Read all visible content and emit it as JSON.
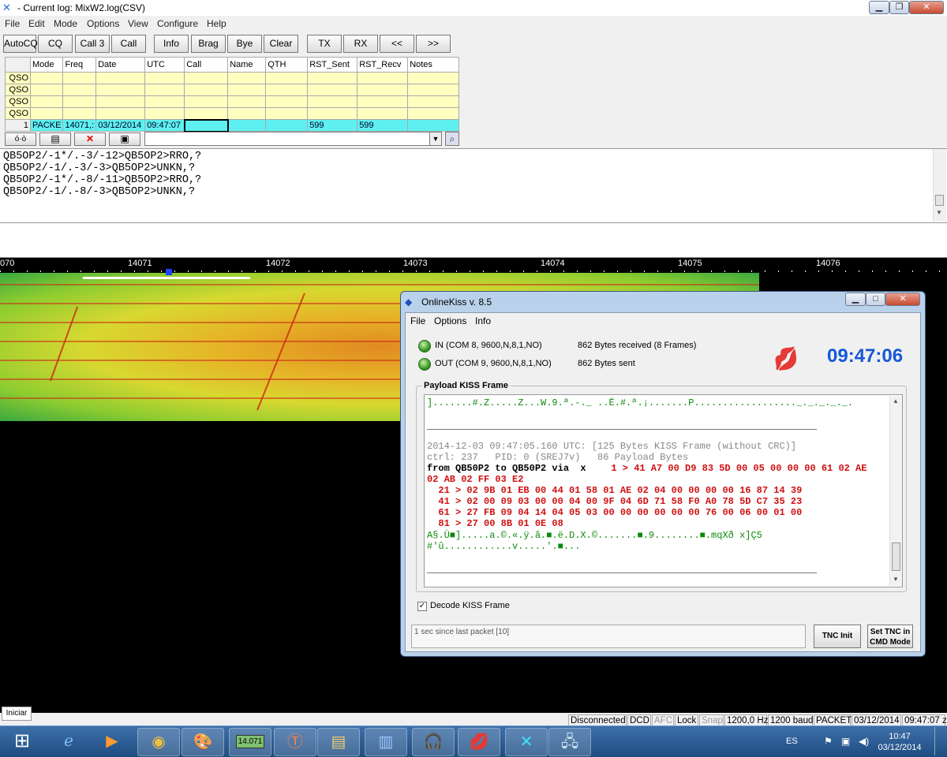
{
  "window": {
    "title": "- Current log: MixW2.log(CSV)",
    "min": "▁",
    "max": "❐",
    "close": "✕"
  },
  "menu": [
    "File",
    "Edit",
    "Mode",
    "Options",
    "View",
    "Configure",
    "Help"
  ],
  "toolbar": [
    "AutoCQ",
    "CQ",
    "Call 3",
    "Call",
    "Info",
    "Brag",
    "Bye",
    "Clear",
    "TX",
    "RX",
    "<<",
    ">>"
  ],
  "log": {
    "headers": [
      "",
      "Mode",
      "Freq",
      "Date",
      "UTC",
      "Call",
      "Name",
      "QTH",
      "RST_Sent",
      "RST_Recv",
      "Notes"
    ],
    "rows": [
      [
        "QSO",
        "",
        "",
        "",
        "",
        "",
        "",
        "",
        "",
        "",
        ""
      ],
      [
        "QSO",
        "",
        "",
        "",
        "",
        "",
        "",
        "",
        "",
        "",
        ""
      ],
      [
        "QSO",
        "",
        "",
        "",
        "",
        "",
        "",
        "",
        "",
        "",
        ""
      ],
      [
        "QSO",
        "",
        "",
        "",
        "",
        "",
        "",
        "",
        "",
        "",
        ""
      ],
      [
        "1",
        "PACKE",
        "14071,:",
        "03/12/2014",
        "09:47:07",
        "",
        "",
        "",
        "599",
        "599",
        ""
      ]
    ]
  },
  "rx_lines": [
    "QB5OP2/-1*/.-3/-12>QB5OP2>RRO,?",
    "QB5OP2/-1/.-3/-3>QB5OP2>UNKN,?",
    "QB5OP2/-1*/.-8/-11>QB5OP2>RRO,?",
    "QB5OP2/-1/.-8/-3>QB5OP2>UNKN,?"
  ],
  "ruler": [
    "070",
    "14071",
    "14072",
    "14073",
    "14074",
    "14075",
    "14076"
  ],
  "onlinekiss": {
    "title": "OnlineKiss v. 8.5",
    "menu": [
      "File",
      "Options",
      "Info"
    ],
    "in_port": "IN (COM 8, 9600,N,8,1,NO)",
    "out_port": "OUT (COM 9, 9600,N,8,1,NO)",
    "received": "862 Bytes received (8 Frames)",
    "sent": "862 Bytes sent",
    "clock": "09:47:06",
    "payload_title": "Payload KISS Frame",
    "payload_top": "].......#.Z.....Z...W.9.ª.-._ ..Ë.#.ª.¡.......P.................._._._._._.",
    "frame_header": "2014-12-03 09:47:05.160 UTC: [125 Bytes KISS Frame (without CRC)]",
    "frame_ctrl": "ctrl: 237   PID: 0 (SREJ7v)   86 Payload Bytes",
    "from_line": "from QB50P2 to QB50P2 via  x",
    "from_hex": "  1 > 41 A7 00 D9 83 5D 00 05 00 00 00 61 02 AE",
    "hex_lines": [
      "02 AB 02 FF 03 E2",
      "  21 > 02 9B 01 EB 00 44 01 58 01 AE 02 04 00 00 00 00 16 87 14 39",
      "  41 > 02 00 09 03 00 00 04 00 9F 04 6D 71 58 F0 A0 78 5D C7 35 23",
      "  61 > 27 FB 09 04 14 04 05 03 00 00 00 00 00 00 76 00 06 00 01 00",
      "  81 > 27 00 8B 01 0E 08"
    ],
    "ascii_lines": [
      "A§.Ù■].....a.©.«.ÿ.â.■.ë.D.X.©.......■.9........■.mqXð x]Ç5",
      "#'û............v.....'.■..."
    ],
    "decode_label": "Decode KISS Frame",
    "decode_checked": "✓",
    "status": "1 sec since last packet [10]",
    "btn_init": "TNC Init",
    "btn_cmd_1": "Set TNC in",
    "btn_cmd_2": "CMD Mode"
  },
  "status": {
    "connected": "Disconnected",
    "dcd": "DCD",
    "afc": "AFC",
    "lock": "Lock",
    "snap": "Snap",
    "hz": "1200,0 Hz",
    "baud": "1200 baud",
    "mode": "PACKET",
    "date": "03/12/2014",
    "time": "09:47:07 z"
  },
  "iniciar": "Iniciar",
  "taskbar": {
    "lang": "ES",
    "time": "10:47",
    "date": "03/12/2014",
    "freq_icon": "14.071"
  },
  "small_buttons": [
    "&#",
    "▤",
    "✕",
    "💾"
  ]
}
